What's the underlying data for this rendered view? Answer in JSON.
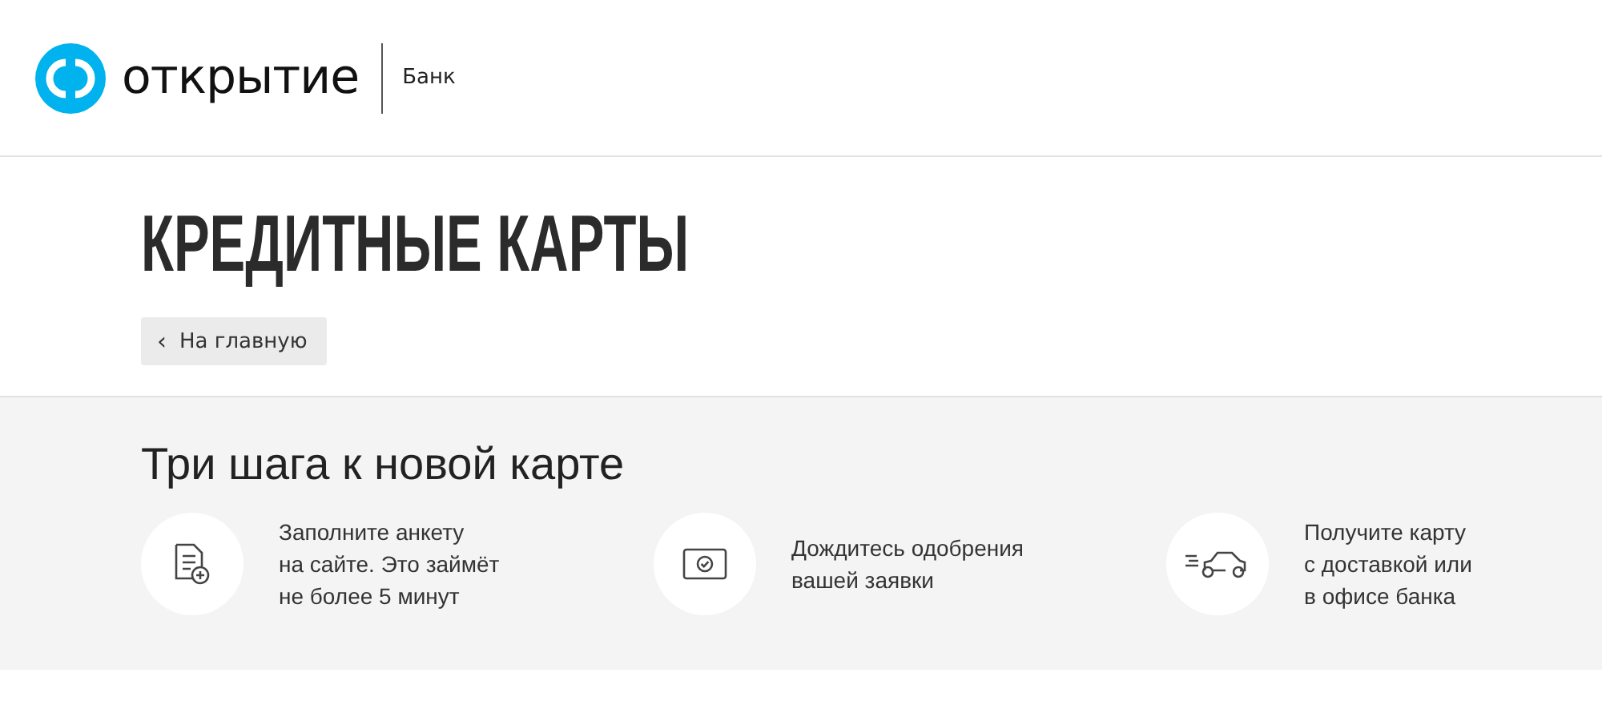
{
  "header": {
    "logo_text": "открытие",
    "bank_label": "Банк"
  },
  "page_title": "КРЕДИТНЫЕ КАРТЫ",
  "back_button": {
    "arrow": "‹",
    "label": "На главную"
  },
  "steps_section": {
    "title": "Три шага к новой карте",
    "steps": [
      {
        "kind": "form",
        "lines": [
          "Заполните анкету",
          "на сайте. Это займёт",
          "не более 5 минут"
        ]
      },
      {
        "kind": "approval",
        "lines": [
          "Дождитесь одобрения",
          "вашей заявки"
        ]
      },
      {
        "kind": "delivery",
        "lines": [
          "Получите карту",
          "с доставкой или",
          "в офисе банка"
        ]
      }
    ]
  }
}
